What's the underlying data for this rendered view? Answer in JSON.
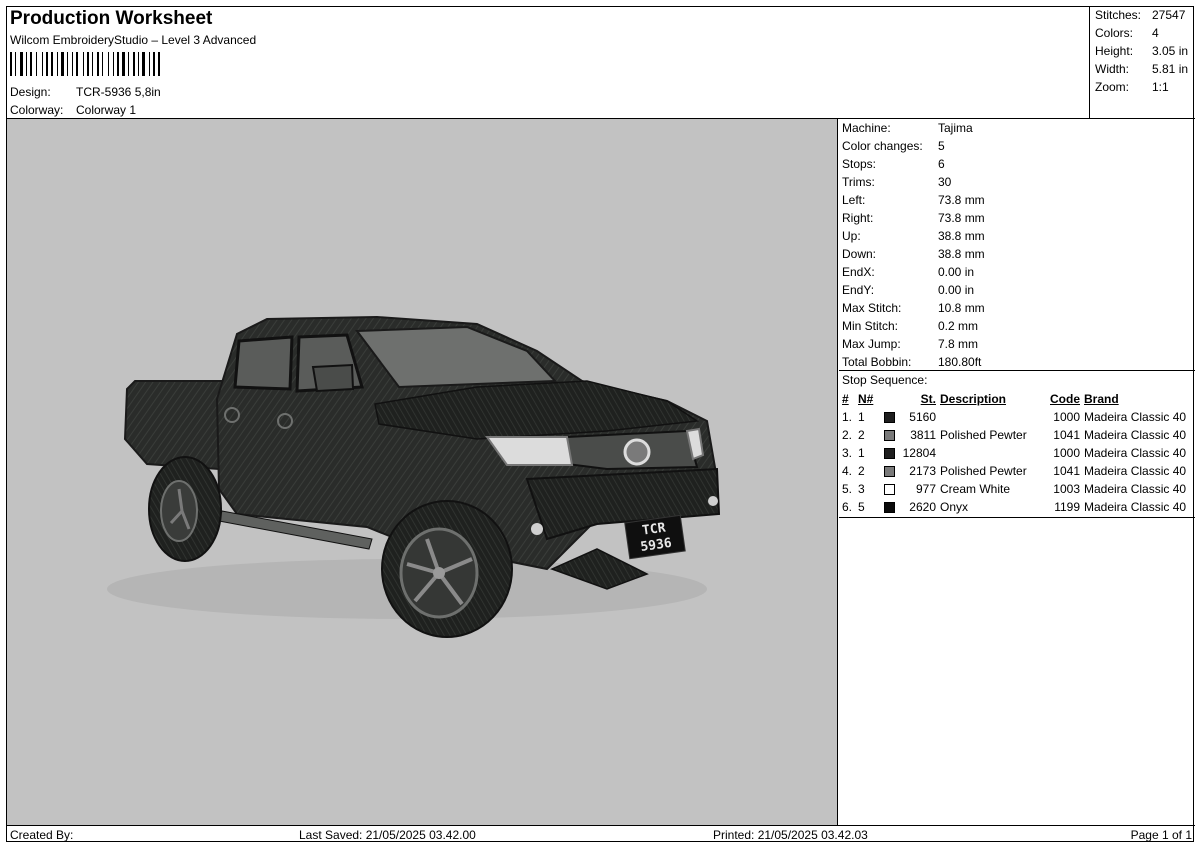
{
  "header": {
    "title": "Production Worksheet",
    "subtitle": "Wilcom EmbroideryStudio – Level 3 Advanced",
    "design_label": "Design:",
    "design_value": "TCR-5936 5,8in",
    "colorway_label": "Colorway:",
    "colorway_value": "Colorway 1"
  },
  "summary": [
    {
      "label": "Stitches:",
      "value": "27547"
    },
    {
      "label": "Colors:",
      "value": "4"
    },
    {
      "label": "Height:",
      "value": "3.05 in"
    },
    {
      "label": "Width:",
      "value": "5.81 in"
    },
    {
      "label": "Zoom:",
      "value": "1:1"
    }
  ],
  "machine": [
    {
      "label": "Machine:",
      "value": "Tajima"
    },
    {
      "label": "Color changes:",
      "value": "5"
    },
    {
      "label": "Stops:",
      "value": "6"
    },
    {
      "label": "Trims:",
      "value": "30"
    },
    {
      "label": "Left:",
      "value": "73.8 mm"
    },
    {
      "label": "Right:",
      "value": "73.8 mm"
    },
    {
      "label": "Up:",
      "value": "38.8 mm"
    },
    {
      "label": "Down:",
      "value": "38.8 mm"
    },
    {
      "label": "EndX:",
      "value": "0.00 in"
    },
    {
      "label": "EndY:",
      "value": "0.00 in"
    },
    {
      "label": "Max Stitch:",
      "value": "10.8 mm"
    },
    {
      "label": "Min Stitch:",
      "value": "0.2 mm"
    },
    {
      "label": "Max Jump:",
      "value": "7.8 mm"
    },
    {
      "label": "Total Bobbin:",
      "value": "180.80ft"
    }
  ],
  "stop_sequence": {
    "heading": "Stop Sequence:",
    "columns": {
      "num": "#",
      "n": "N#",
      "st": "St.",
      "desc": "Description",
      "code": "Code",
      "brand": "Brand"
    },
    "rows": [
      {
        "num": "1.",
        "n": "1",
        "color": "#1e1e1e",
        "st": "5160",
        "desc": "",
        "code": "1000",
        "brand": "Madeira Classic 40"
      },
      {
        "num": "2.",
        "n": "2",
        "color": "#7a7a7a",
        "st": "3811",
        "desc": "Polished Pewter",
        "code": "1041",
        "brand": "Madeira Classic 40"
      },
      {
        "num": "3.",
        "n": "1",
        "color": "#1e1e1e",
        "st": "12804",
        "desc": "",
        "code": "1000",
        "brand": "Madeira Classic 40"
      },
      {
        "num": "4.",
        "n": "2",
        "color": "#7a7a7a",
        "st": "2173",
        "desc": "Polished Pewter",
        "code": "1041",
        "brand": "Madeira Classic 40"
      },
      {
        "num": "5.",
        "n": "3",
        "color": "#ffffff",
        "st": "977",
        "desc": "Cream White",
        "code": "1003",
        "brand": "Madeira Classic 40"
      },
      {
        "num": "6.",
        "n": "5",
        "color": "#0a0a0a",
        "st": "2620",
        "desc": "Onyx",
        "code": "1199",
        "brand": "Madeira Classic 40"
      }
    ]
  },
  "preview": {
    "background_color": "#c2c2c2",
    "plate_line1": "TCR",
    "plate_line2": "5936"
  },
  "footer": {
    "created_by": "Created By:",
    "last_saved": "Last Saved: 21/05/2025 03.42.00",
    "printed": "Printed: 21/05/2025 03.42.03",
    "page": "Page 1 of 1"
  }
}
